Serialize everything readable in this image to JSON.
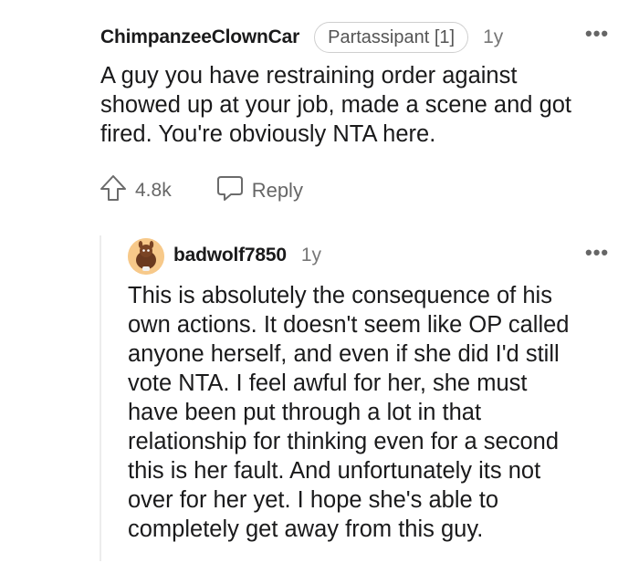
{
  "comments": [
    {
      "username": "ChimpanzeeClownCar",
      "flair": "Partassipant [1]",
      "age": "1y",
      "more_label": "•••",
      "body": "A guy you have restraining order against\nshowed up at your job, made a scene and got\nfired. You're obviously NTA here.",
      "upvotes": "4.8k",
      "reply_label": "Reply",
      "icons": [
        "upvote-arrow-icon",
        "chat-bubble-icon",
        "more-options-icon"
      ]
    },
    {
      "username": "badwolf7850",
      "age": "1y",
      "more_label": "•••",
      "body": "This is absolutely the consequence of his\nown actions. It doesn't seem like OP called\nanyone herself, and even if she did I'd still\nvote NTA. I feel awful for her, she must\nhave been put through a lot in that\nrelationship for thinking even for a second\nthis is her fault. And unfortunately its not\nover for her yet. I hope she's able to\ncompletely get away from this guy.",
      "icons": [
        "avatar",
        "more-options-icon"
      ]
    }
  ],
  "colors": {
    "text": "#1a1a1b",
    "muted": "#777777",
    "flair_border": "#cfcfcf",
    "avatar_bg": "#f5c98a",
    "thread_line": "#ececec"
  }
}
